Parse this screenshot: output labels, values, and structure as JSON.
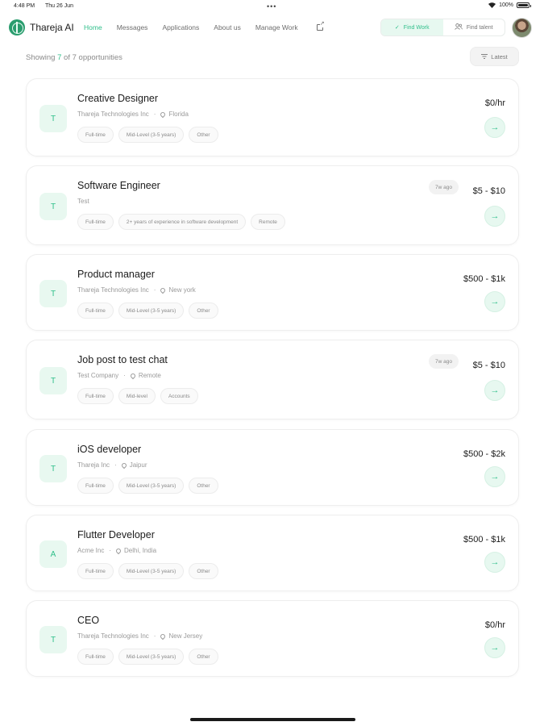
{
  "status": {
    "time": "4:48 PM",
    "date": "Thu 26 Jun",
    "battery": "100%"
  },
  "brand": {
    "name": "Thareja AI"
  },
  "nav": {
    "links": [
      "Home",
      "Messages",
      "Applications",
      "About us",
      "Manage Work"
    ],
    "active": "Home"
  },
  "mode_toggle": {
    "find_work": "Find Work",
    "find_talent": "Find talent",
    "selected": "Find Work"
  },
  "summary": {
    "prefix": "Showing ",
    "shown": "7",
    "middle": " of ",
    "total": "7",
    "suffix": " opportunities"
  },
  "sort": {
    "label": "Latest"
  },
  "colors": {
    "accent": "#2fbf8a",
    "accent_bg": "#e7f8f0"
  },
  "jobs": [
    {
      "initial": "T",
      "title": "Creative Designer",
      "company": "Thareja Technologies Inc",
      "location": "Florida",
      "tags": [
        "Full-time",
        "Mid-Level (3-5 years)",
        "Other"
      ],
      "rate": "$0/hr",
      "age": ""
    },
    {
      "initial": "T",
      "title": "Software Engineer",
      "company": "Test",
      "location": "",
      "tags": [
        "Full-time",
        "2+ years of experience in software development",
        "Remote"
      ],
      "rate": "$5 - $10",
      "age": "7w ago"
    },
    {
      "initial": "T",
      "title": "Product manager",
      "company": "Thareja Technologies Inc",
      "location": "New york",
      "tags": [
        "Full-time",
        "Mid-Level (3-5 years)",
        "Other"
      ],
      "rate": "$500 - $1k",
      "age": ""
    },
    {
      "initial": "T",
      "title": "Job post to test chat",
      "company": "Test Company",
      "location": "Remote",
      "tags": [
        "Full-time",
        "Mid-level",
        "Accounts"
      ],
      "rate": "$5 - $10",
      "age": "7w ago"
    },
    {
      "initial": "T",
      "title": "iOS developer",
      "company": "Thareja Inc",
      "location": "Jaipur",
      "tags": [
        "Full-time",
        "Mid-Level (3-5 years)",
        "Other"
      ],
      "rate": "$500 - $2k",
      "age": ""
    },
    {
      "initial": "A",
      "title": "Flutter Developer",
      "company": "Acme Inc",
      "location": "Delhi, India",
      "tags": [
        "Full-time",
        "Mid-Level (3-5 years)",
        "Other"
      ],
      "rate": "$500 - $1k",
      "age": ""
    },
    {
      "initial": "T",
      "title": "CEO",
      "company": "Thareja Technologies Inc",
      "location": "New Jersey",
      "tags": [
        "Full-time",
        "Mid-Level (3-5 years)",
        "Other"
      ],
      "rate": "$0/hr",
      "age": ""
    }
  ]
}
